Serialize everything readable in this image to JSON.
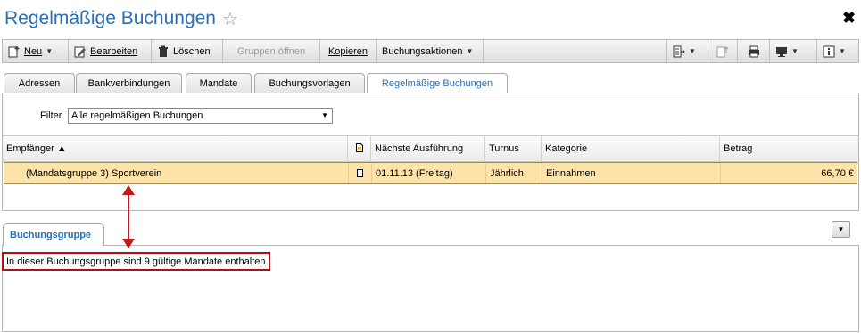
{
  "window": {
    "title": "Regelmäßige Buchungen",
    "star": "☆",
    "close": "✖"
  },
  "toolbar": {
    "neu": "Neu",
    "bearbeiten": "Bearbeiten",
    "loeschen": "Löschen",
    "gruppen_oeffnen": "Gruppen öffnen",
    "kopieren": "Kopieren",
    "buchungsaktionen": "Buchungsaktionen",
    "icons": [
      "export-icon",
      "import-icon",
      "print-icon",
      "monitor-icon",
      "info-icon"
    ]
  },
  "tabs": [
    {
      "label": "Adressen"
    },
    {
      "label": "Bankverbindungen"
    },
    {
      "label": "Mandate"
    },
    {
      "label": "Buchungsvorlagen"
    },
    {
      "label": "Regelmäßige Buchungen",
      "active": true
    }
  ],
  "filter": {
    "label": "Filter",
    "value": "Alle regelmäßigen Buchungen"
  },
  "table": {
    "columns": [
      "Empfänger ▲",
      "",
      "Nächste Ausführung",
      "Turnus",
      "Kategorie",
      "Betrag"
    ],
    "rows": [
      {
        "empfaenger": "(Mandatsgruppe 3) Sportverein",
        "naechste": "01.11.13 (Freitag)",
        "turnus": "Jährlich",
        "kategorie": "Einnahmen",
        "betrag": "66,70 €"
      }
    ]
  },
  "detail": {
    "tab_label": "Buchungsgruppe",
    "text": "In dieser Buchungsgruppe sind 9 gültige Mandate enthalten."
  },
  "colors": {
    "accent": "#2a6fb5",
    "selected_row": "#fde3a8",
    "annotation": "#c0191b"
  }
}
